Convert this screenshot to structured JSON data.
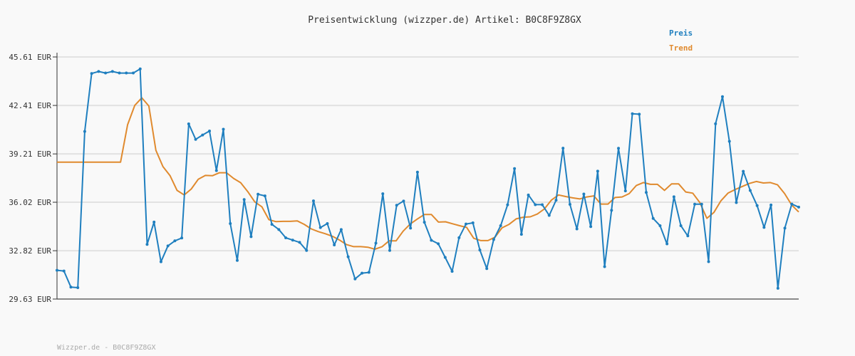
{
  "chart_data": {
    "type": "line",
    "title": "Preisentwicklung (wizzper.de) Artikel: B0C8F9Z8GX",
    "ylim": [
      29.63,
      45.61
    ],
    "y_ticks": [
      "45.61 EUR",
      "42.41 EUR",
      "39.21 EUR",
      "36.02 EUR",
      "32.82 EUR",
      "29.63 EUR"
    ],
    "y_tick_values": [
      45.61,
      42.41,
      39.21,
      36.02,
      32.82,
      29.63
    ],
    "grid": true,
    "legend_position": "top-right",
    "series": [
      {
        "name": "Preis",
        "color": "#1f7fbf",
        "values": [
          31.53,
          31.48,
          30.42,
          30.38,
          40.69,
          44.52,
          44.65,
          44.55,
          44.65,
          44.55,
          44.55,
          44.55,
          44.82,
          33.24,
          34.71,
          32.09,
          33.14,
          33.47,
          33.66,
          41.19,
          40.17,
          40.46,
          40.72,
          38.11,
          40.84,
          34.61,
          32.18,
          36.2,
          33.75,
          36.55,
          36.44,
          34.56,
          34.22,
          33.67,
          33.52,
          33.37,
          32.84,
          36.11,
          34.35,
          34.61,
          33.2,
          34.22,
          32.42,
          30.96,
          31.34,
          31.39,
          33.32,
          36.58,
          32.84,
          35.82,
          36.1,
          34.31,
          38.01,
          34.7,
          33.51,
          33.28,
          32.38,
          31.46,
          33.68,
          34.58,
          34.66,
          32.87,
          31.64,
          33.56,
          34.47,
          35.85,
          38.24,
          33.9,
          36.5,
          35.86,
          35.86,
          35.15,
          36.16,
          39.59,
          35.88,
          34.26,
          36.56,
          34.41,
          38.07,
          31.77,
          35.49,
          39.58,
          36.77,
          41.86,
          41.83,
          36.67,
          34.95,
          34.47,
          33.27,
          36.38,
          34.47,
          33.8,
          35.89,
          35.89,
          32.1,
          41.2,
          42.99,
          40.04,
          36.0,
          38.06,
          36.8,
          35.8,
          34.36,
          35.84,
          30.34,
          34.31,
          35.9,
          35.7
        ]
      },
      {
        "name": "Trend",
        "color": "#e08a2e",
        "values": [
          38.67,
          38.67,
          38.67,
          38.67,
          38.67,
          38.67,
          38.67,
          38.67,
          38.67,
          38.67,
          41.14,
          42.41,
          42.91,
          42.37,
          39.45,
          38.37,
          37.78,
          36.8,
          36.5,
          36.89,
          37.54,
          37.79,
          37.77,
          37.97,
          37.97,
          37.59,
          37.31,
          36.72,
          36.04,
          35.72,
          34.87,
          34.74,
          34.76,
          34.76,
          34.79,
          34.56,
          34.26,
          34.08,
          33.94,
          33.77,
          33.52,
          33.22,
          33.09,
          33.09,
          33.05,
          32.92,
          33.08,
          33.47,
          33.47,
          34.11,
          34.58,
          34.91,
          35.21,
          35.21,
          34.71,
          34.73,
          34.6,
          34.47,
          34.36,
          33.64,
          33.49,
          33.49,
          33.71,
          34.33,
          34.56,
          34.92,
          35.03,
          35.06,
          35.24,
          35.58,
          36.17,
          36.5,
          36.4,
          36.31,
          36.24,
          36.37,
          36.44,
          35.9,
          35.9,
          36.33,
          36.37,
          36.59,
          37.12,
          37.32,
          37.2,
          37.2,
          36.8,
          37.23,
          37.23,
          36.7,
          36.62,
          36.0,
          34.96,
          35.35,
          36.12,
          36.63,
          36.86,
          37.06,
          37.26,
          37.39,
          37.29,
          37.32,
          37.17,
          36.59,
          35.84,
          35.38
        ]
      }
    ],
    "footer_text": "Wizzper.de - B0C8F9Z8GX"
  }
}
